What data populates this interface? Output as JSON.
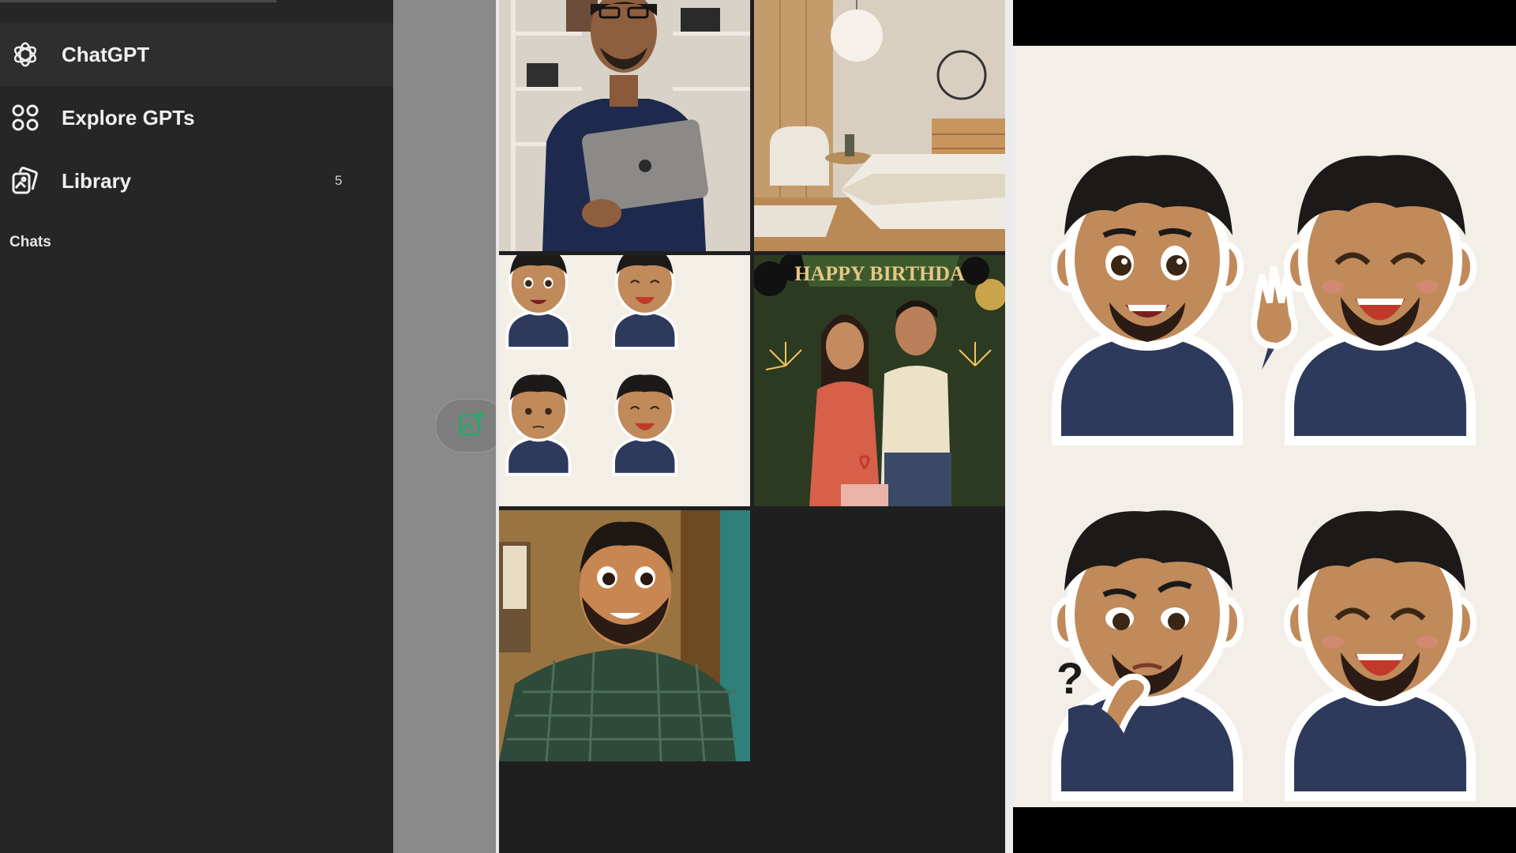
{
  "sidebar": {
    "items": [
      {
        "label": "ChatGPT",
        "icon": "openai-logo-icon"
      },
      {
        "label": "Explore GPTs",
        "icon": "grid-dots-icon"
      },
      {
        "label": "Library",
        "icon": "library-images-icon",
        "badge": "5"
      }
    ],
    "section_title": "Chats"
  },
  "floating_button": {
    "icon": "image-edit-icon",
    "color": "#2ea56b"
  },
  "gallery": {
    "tiles": [
      {
        "name": "photo-man-holding-laptop"
      },
      {
        "name": "photo-bedroom-interior"
      },
      {
        "name": "sticker-sheet-small"
      },
      {
        "name": "illustration-birthday-couple",
        "banner_text": "HAPPY BIRTHDA"
      },
      {
        "name": "illustration-man-selfie"
      }
    ]
  },
  "viewer": {
    "name": "sticker-sheet-large"
  },
  "colors": {
    "sidebar_bg": "#262626",
    "gallery_bg": "#1f1f1f",
    "navy_shirt": "#2e3a5c",
    "skin": "#c08a5a",
    "hair": "#1c1a18"
  }
}
